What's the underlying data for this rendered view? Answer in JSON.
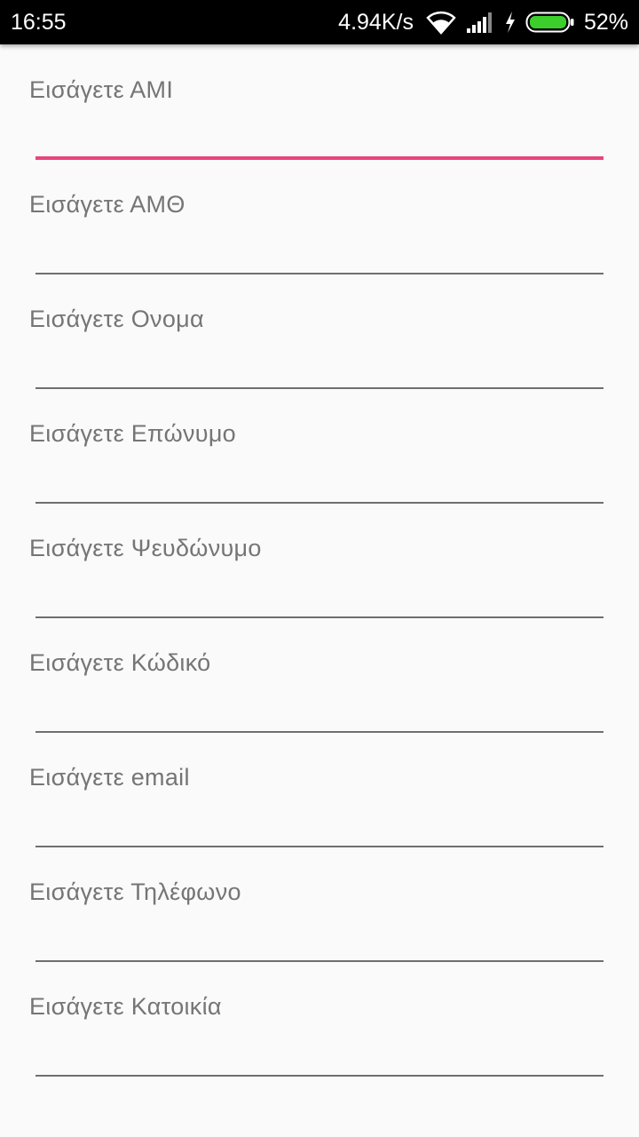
{
  "status_bar": {
    "time": "16:55",
    "network_speed": "4.94K/s",
    "battery_percent": "52%",
    "battery_level": 0.52,
    "icons": [
      "wifi-icon",
      "signal-icon",
      "charging-icon",
      "battery-icon"
    ]
  },
  "form": {
    "accent_color": "#e8457c",
    "fields": [
      {
        "label": "Εισάγετε ΑΜΙ",
        "value": "",
        "focused": true
      },
      {
        "label": "Εισάγετε ΑΜΘ",
        "value": ""
      },
      {
        "label": "Εισάγετε Ονομα",
        "value": ""
      },
      {
        "label": "Εισάγετε Επώνυμο",
        "value": ""
      },
      {
        "label": "Εισάγετε Ψευδώνυμο",
        "value": ""
      },
      {
        "label": "Εισάγετε Κώδικό",
        "value": ""
      },
      {
        "label": "Εισάγετε email",
        "value": ""
      },
      {
        "label": "Εισάγετε Τηλέφωνο",
        "value": ""
      },
      {
        "label": "Εισάγετε Κατοικία",
        "value": ""
      }
    ]
  }
}
